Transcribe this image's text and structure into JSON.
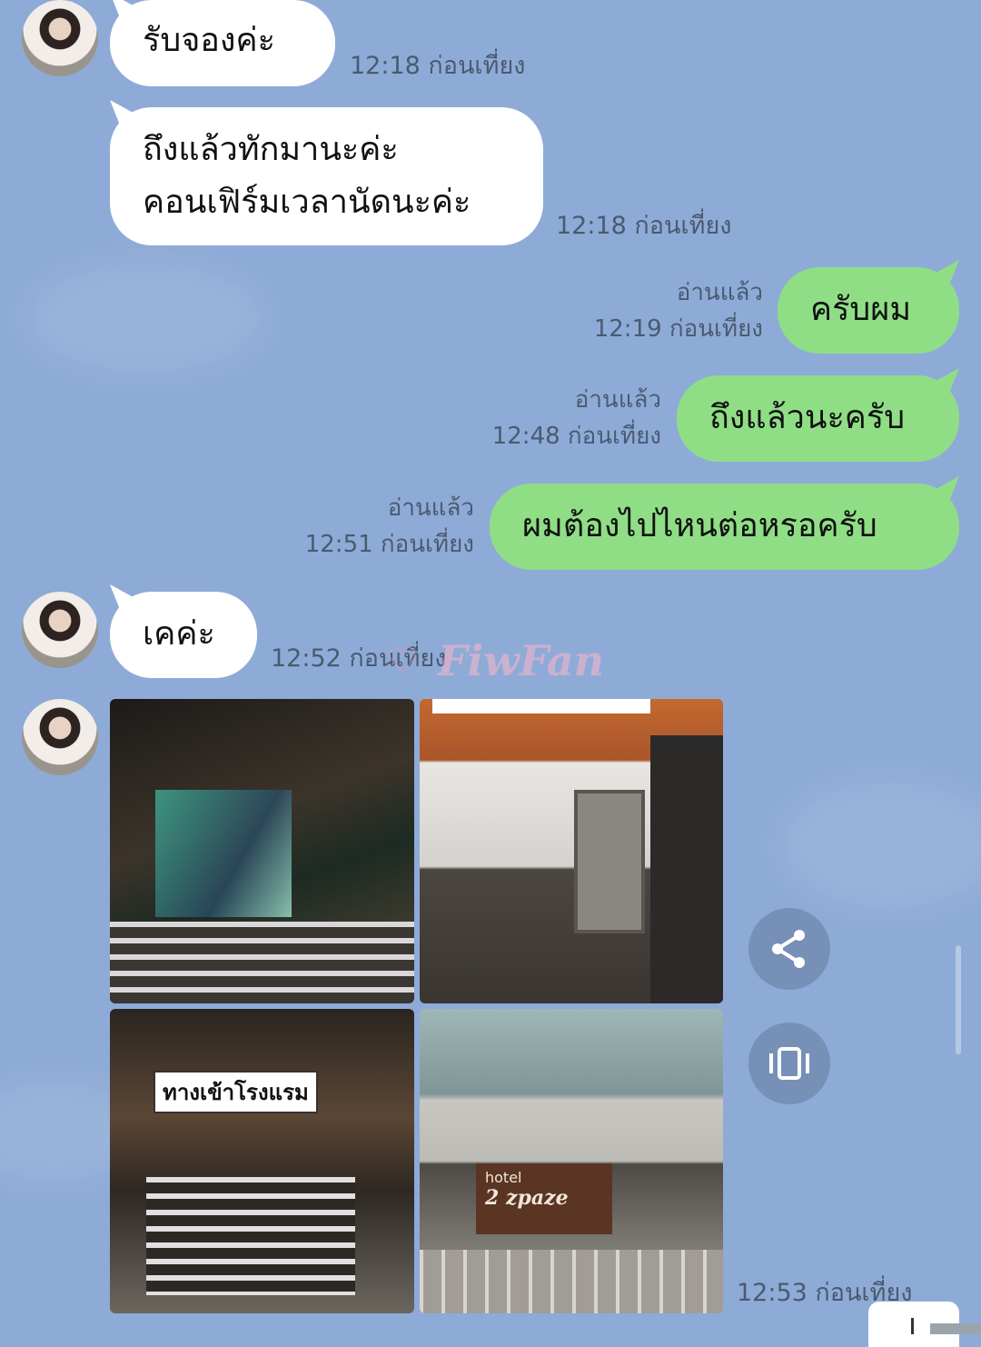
{
  "messages": [
    {
      "id": "m1",
      "sender": "contact",
      "lines": [
        "รับจองค่ะ"
      ],
      "time": "12:18 ก่อนเที่ยง"
    },
    {
      "id": "m2",
      "sender": "contact",
      "lines": [
        "ถึงแล้วทักมานะค่ะ",
        "คอนเฟิร์มเวลานัดนะค่ะ"
      ],
      "time": "12:18 ก่อนเที่ยง"
    },
    {
      "id": "m3",
      "sender": "me",
      "lines": [
        "ครับผม"
      ],
      "read": "อ่านแล้ว",
      "time": "12:19 ก่อนเที่ยง"
    },
    {
      "id": "m4",
      "sender": "me",
      "lines": [
        "ถึงแล้วนะครับ"
      ],
      "read": "อ่านแล้ว",
      "time": "12:48 ก่อนเที่ยง"
    },
    {
      "id": "m5",
      "sender": "me",
      "lines": [
        "ผมต้องไปไหนต่อหรอครับ"
      ],
      "read": "อ่านแล้ว",
      "time": "12:51 ก่อนเที่ยง"
    },
    {
      "id": "m6",
      "sender": "contact",
      "lines": [
        "เคค่ะ"
      ],
      "time": "12:52 ก่อนเที่ยง"
    },
    {
      "id": "m7",
      "sender": "contact",
      "type": "photo-grid",
      "time": "12:53 ก่อนเที่ยง",
      "photos": [
        {
          "caption": ""
        },
        {
          "caption": ""
        },
        {
          "caption": "ทางเข้าโรงแรม"
        },
        {
          "caption": "hotel",
          "sign": "2 zpaze"
        }
      ]
    }
  ],
  "watermark": "FiwFan",
  "actions": {
    "share_icon": "share-icon",
    "expand_icon": "carousel-icon"
  },
  "colors": {
    "background": "#8eabd7",
    "incoming_bubble": "#ffffff",
    "outgoing_bubble": "#8fde86"
  }
}
